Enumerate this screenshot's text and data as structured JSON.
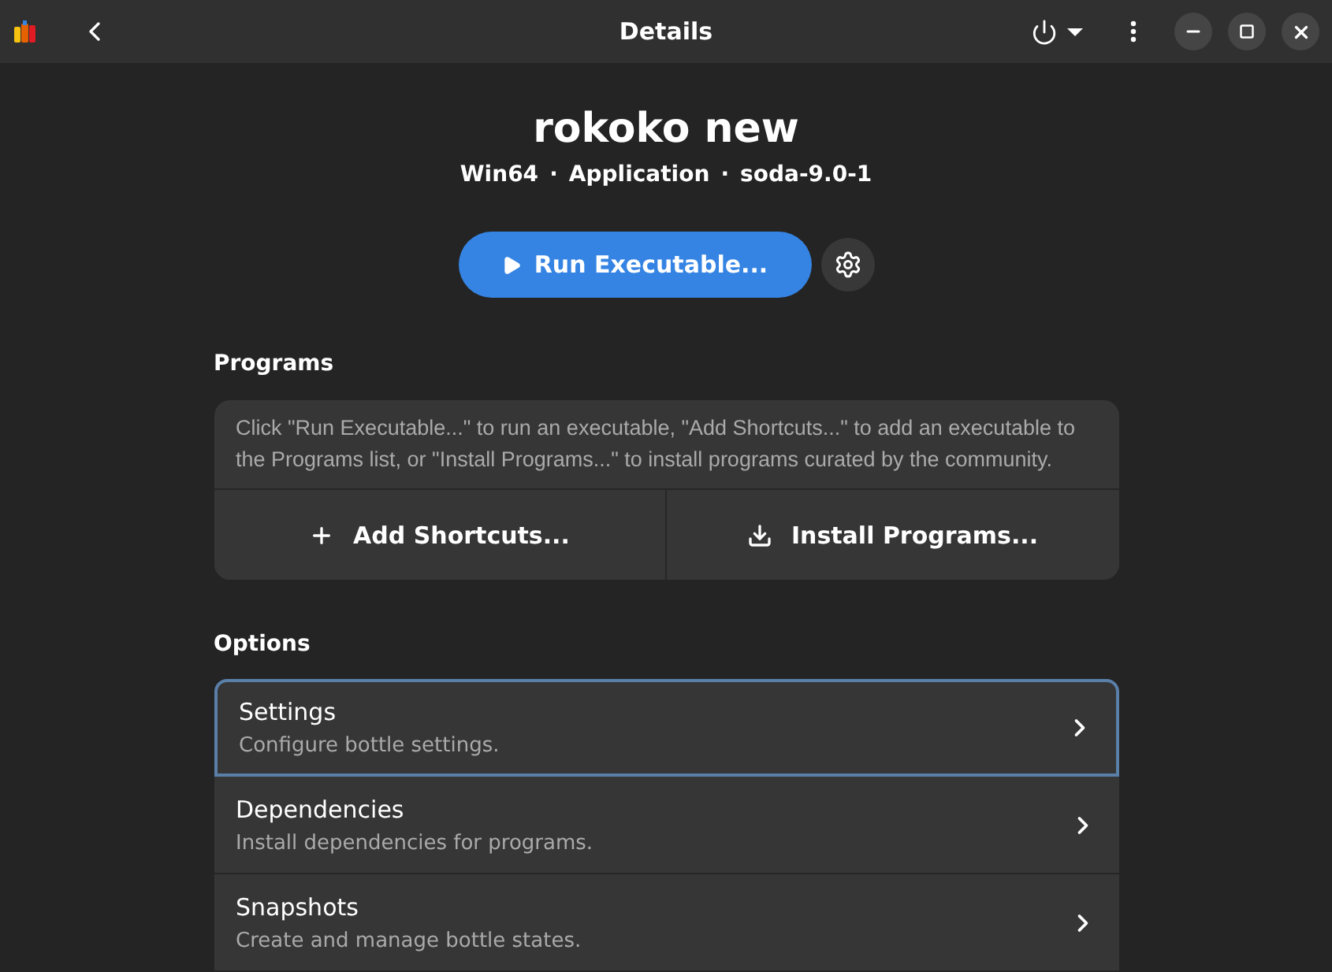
{
  "header": {
    "title": "Details"
  },
  "bottle": {
    "name": "rokoko new",
    "meta": [
      "Win64",
      "Application",
      "soda-9.0-1"
    ],
    "separator": "·"
  },
  "run_button": {
    "label": "Run Executable..."
  },
  "programs": {
    "heading": "Programs",
    "description": "Click \"Run Executable...\" to run an executable, \"Add Shortcuts...\" to add an executable to the Programs list, or \"Install Programs...\" to install programs curated by the community.",
    "actions": [
      {
        "kind": "add",
        "label": "Add Shortcuts..."
      },
      {
        "kind": "install",
        "label": "Install Programs..."
      }
    ]
  },
  "options": {
    "heading": "Options",
    "items": [
      {
        "title": "Settings",
        "subtitle": "Configure bottle settings.",
        "focused": true
      },
      {
        "title": "Dependencies",
        "subtitle": "Install dependencies for programs.",
        "focused": false
      },
      {
        "title": "Snapshots",
        "subtitle": "Create and manage bottle states.",
        "focused": false
      }
    ]
  }
}
